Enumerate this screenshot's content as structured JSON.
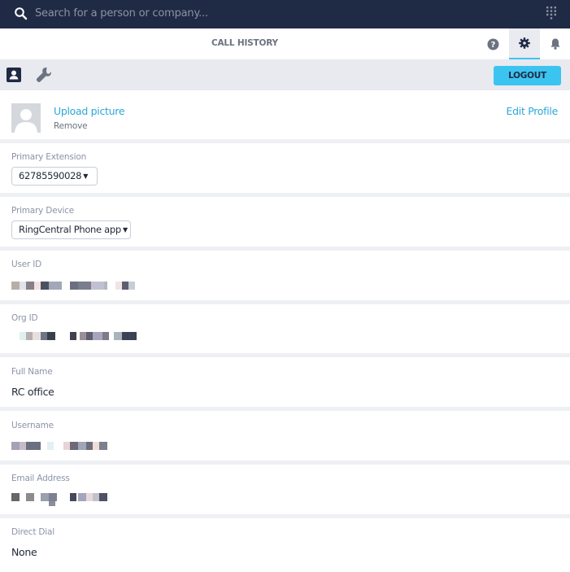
{
  "search": {
    "placeholder": "Search for a person or company..."
  },
  "nav": {
    "title": "CALL HISTORY"
  },
  "toolbar": {
    "logout_label": "LOGOUT"
  },
  "profile": {
    "upload_label": "Upload picture",
    "remove_label": "Remove",
    "edit_label": "Edit Profile"
  },
  "fields": {
    "primary_extension": {
      "label": "Primary Extension",
      "value": "62785590028"
    },
    "primary_device": {
      "label": "Primary Device",
      "value": "RingCentral Phone app"
    },
    "user_id": {
      "label": "User ID"
    },
    "org_id": {
      "label": "Org ID"
    },
    "full_name": {
      "label": "Full Name",
      "value": "RC office"
    },
    "username": {
      "label": "Username"
    },
    "email": {
      "label": "Email Address"
    },
    "direct_dial": {
      "label": "Direct Dial",
      "value": "None"
    }
  },
  "colors": {
    "topbar": "#1f2a44",
    "accent": "#3cc4f1",
    "link": "#2ba7d8"
  },
  "icons": [
    "search-icon",
    "dialpad-icon",
    "help-icon",
    "gear-icon",
    "bell-icon",
    "contact-card-icon",
    "wrench-icon",
    "avatar-placeholder-icon"
  ]
}
